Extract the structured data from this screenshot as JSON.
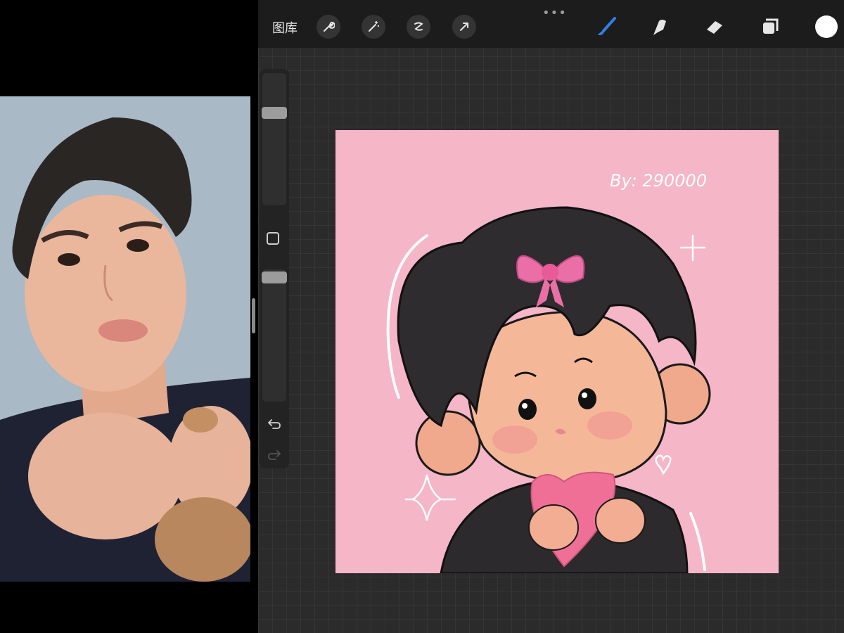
{
  "toolbar": {
    "gallery_label": "图库",
    "more_icon": "ellipsis-icon",
    "left_tools": [
      "wrench-icon",
      "magic-wand-icon",
      "selection-icon",
      "transform-arrow-icon"
    ],
    "right_tools": [
      "brush-icon",
      "smudge-icon",
      "eraser-icon",
      "layers-icon"
    ],
    "active_tool": "brush-icon",
    "current_color": "#ffffff",
    "accent_color": "#2f7fe6"
  },
  "sidebar": {
    "brush_size_level": 0.72,
    "opacity_level": 0.98,
    "icons": [
      "modify-square-icon",
      "undo-icon",
      "redo-icon"
    ]
  },
  "canvas": {
    "background_color": "#f5b6c8",
    "signature_text": "By: 290000"
  },
  "reference_photo": {
    "subject": "portrait-photo"
  }
}
